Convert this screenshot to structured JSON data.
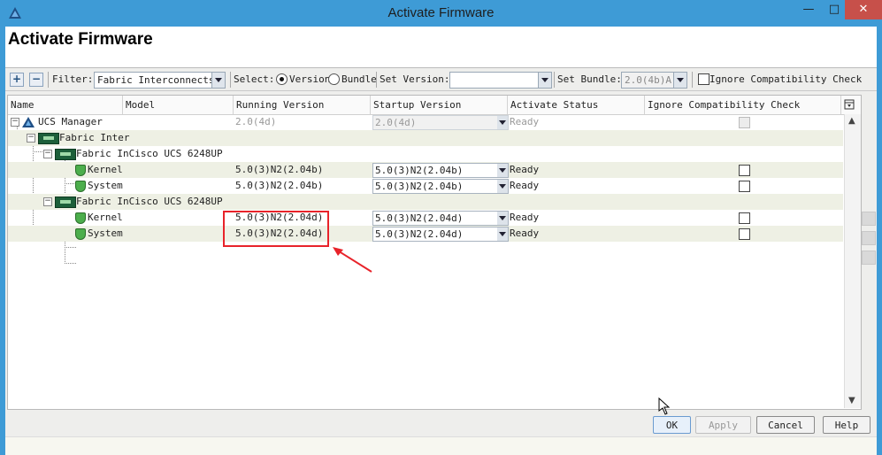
{
  "window": {
    "title": "Activate Firmware",
    "minimize": "—",
    "maximize": "□",
    "close": "✕"
  },
  "header": {
    "title": "Activate Firmware"
  },
  "toolbar": {
    "add": "+",
    "remove": "−",
    "filter_label": "Filter:",
    "filter_value": "Fabric Interconnects",
    "select_label": "Select:",
    "radio_version": "Version",
    "radio_bundle": "Bundle",
    "set_version_label": "Set Version:",
    "set_version_value": "",
    "set_bundle_label": "Set Bundle:",
    "set_bundle_value": "2.0(4b)A",
    "ignore_label": "Ignore Compatibility Check"
  },
  "table": {
    "columns": [
      "Name",
      "Model",
      "Running Version",
      "Startup Version",
      "Activate Status",
      "Ignore Compatibility Check"
    ],
    "rows": [
      {
        "name": "UCS Manager",
        "model": "",
        "running": "2.0(4d)",
        "startup": "2.0(4d)",
        "status": "Ready"
      },
      {
        "name": "Fabric Inter",
        "model": "",
        "running": "",
        "startup": "",
        "status": ""
      },
      {
        "name": "Fabric InCisco UCS 6248UP",
        "model": "",
        "running": "",
        "startup": "",
        "status": ""
      },
      {
        "name": "Kernel",
        "model": "",
        "running": "5.0(3)N2(2.04b)",
        "startup": "5.0(3)N2(2.04b)",
        "status": "Ready"
      },
      {
        "name": "System",
        "model": "",
        "running": "5.0(3)N2(2.04b)",
        "startup": "5.0(3)N2(2.04b)",
        "status": "Ready"
      },
      {
        "name": "Fabric InCisco UCS 6248UP",
        "model": "",
        "running": "",
        "startup": "",
        "status": ""
      },
      {
        "name": "Kernel",
        "model": "",
        "running": "5.0(3)N2(2.04d)",
        "startup": "5.0(3)N2(2.04d)",
        "status": "Ready"
      },
      {
        "name": "System",
        "model": "",
        "running": "5.0(3)N2(2.04d)",
        "startup": "5.0(3)N2(2.04d)",
        "status": "Ready"
      }
    ]
  },
  "buttons": {
    "ok": "OK",
    "apply": "Apply",
    "cancel": "Cancel",
    "help": "Help"
  },
  "colors": {
    "titlebar": "#3e9bd6",
    "highlight": "#e8232a",
    "close": "#c7504a"
  }
}
